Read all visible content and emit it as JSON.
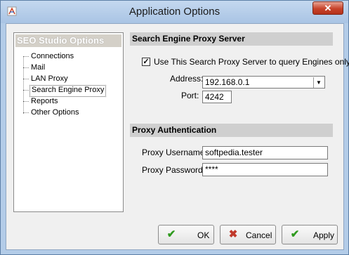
{
  "window": {
    "title": "Application Options",
    "close_glyph": "✕"
  },
  "tree": {
    "header": "SEO Studio Options",
    "items": [
      {
        "label": "Connections"
      },
      {
        "label": "Mail"
      },
      {
        "label": "LAN Proxy"
      },
      {
        "label": "Search Engine Proxy",
        "selected": true
      },
      {
        "label": "Reports"
      },
      {
        "label": "Other Options"
      }
    ]
  },
  "proxy_server": {
    "section_title": "Search Engine Proxy Server",
    "use_proxy_label": "Use This Search Proxy Server to query Engines only",
    "use_proxy_checked": true,
    "address_label": "Address:",
    "address_value": "192.168.0.1",
    "port_label": "Port:",
    "port_value": "4242"
  },
  "proxy_auth": {
    "section_title": "Proxy Authentication",
    "username_label": "Proxy Username:",
    "username_value": "softpedia.tester",
    "password_label": "Proxy Password:",
    "password_value": "****"
  },
  "buttons": {
    "ok": "OK",
    "cancel": "Cancel",
    "apply": "Apply"
  },
  "colors": {
    "check_green": "#2e9a1e",
    "cancel_red": "#c0392b",
    "frame": "#b3cce8"
  },
  "icons": {
    "ok": "checkmark-icon",
    "cancel": "cross-icon",
    "apply": "checkmark-icon"
  }
}
